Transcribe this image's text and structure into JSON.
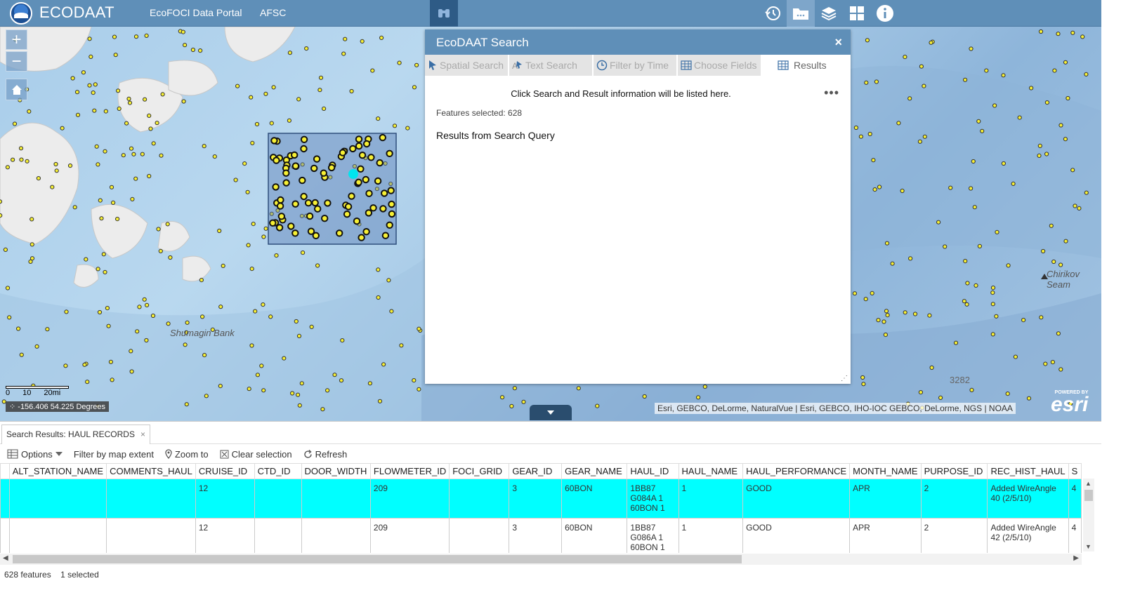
{
  "header": {
    "title": "ECODAAT",
    "links": [
      "EcoFOCI Data Portal",
      "AFSC"
    ],
    "icons": [
      "binoculars-icon",
      "history-icon",
      "folder-icon",
      "layers-icon",
      "grid-icon",
      "info-icon"
    ]
  },
  "map": {
    "zoom_in": "+",
    "zoom_out": "−",
    "scale": {
      "labels": [
        "0",
        "10",
        "20mi"
      ]
    },
    "coordinates": "-156.406 54.225 Degrees",
    "place_labels": [
      "Shumagin Bank",
      "Chirikov Seam",
      "3282"
    ],
    "attribution": "Esri, GEBCO, DeLorme, NaturalVue | Esri, GEBCO, IHO-IOC GEBCO, DeLorme, NGS | NOAA",
    "esri_powered": "POWERED BY",
    "esri": "esri",
    "colors": {
      "point": "#f7f034",
      "selection_box": "#5a7fb5",
      "highlight": "#00e5ee"
    }
  },
  "search_panel": {
    "title": "EcoDAAT Search",
    "close": "×",
    "tabs": [
      {
        "label": "Spatial Search",
        "icon": "cursor-icon"
      },
      {
        "label": "Text Search",
        "icon": "text-cursor-icon"
      },
      {
        "label": "Filter by Time",
        "icon": "clock-icon"
      },
      {
        "label": "Choose Fields",
        "icon": "table-icon"
      },
      {
        "label": "Results",
        "icon": "table-icon"
      }
    ],
    "message": "Click Search and Result information will be listed here.",
    "more": "•••",
    "features_selected": "Features selected: 628",
    "subheading": "Results from Search Query"
  },
  "results": {
    "tab_label": "Search Results: HAUL RECORDS",
    "tab_close": "×",
    "toolbar": {
      "options": "Options",
      "filter": "Filter by map extent",
      "zoom": "Zoom to",
      "clear": "Clear selection",
      "refresh": "Refresh"
    },
    "columns": [
      "ALT_STATION_NAME",
      "COMMENTS_HAUL",
      "CRUISE_ID",
      "CTD_ID",
      "DOOR_WIDTH",
      "FLOWMETER_ID",
      "FOCI_GRID",
      "GEAR_ID",
      "GEAR_NAME",
      "HAUL_ID",
      "HAUL_NAME",
      "HAUL_PERFORMANCE",
      "MONTH_NAME",
      "PURPOSE_ID",
      "REC_HIST_HAUL",
      "S"
    ],
    "rows": [
      [
        "",
        "",
        "12",
        "",
        "",
        "209",
        "",
        "3",
        "60BON",
        "1BB87 G084A 1 60BON 1",
        "1",
        "GOOD",
        "APR",
        "2",
        "Added WireAngle 40 (2/5/10)",
        "4"
      ],
      [
        "",
        "",
        "12",
        "",
        "",
        "209",
        "",
        "3",
        "60BON",
        "1BB87 G086A 1 60BON 1",
        "1",
        "GOOD",
        "APR",
        "2",
        "Added WireAngle 42 (2/5/10)",
        "4"
      ]
    ],
    "status": {
      "features": "628 features",
      "selected": "1 selected"
    }
  }
}
